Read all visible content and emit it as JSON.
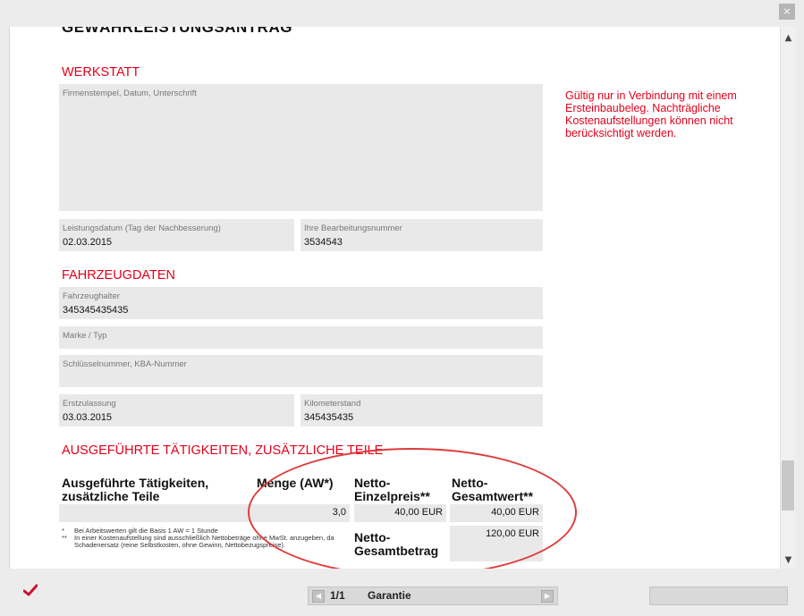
{
  "window": {
    "close_label": "×"
  },
  "document": {
    "title": "GEWÄHRLEISTUNGSANTRAG",
    "werkstatt": {
      "heading": "WERKSTATT",
      "stamp_label": "Firmenstempel, Datum, Unterschrift",
      "leistungsdatum_label": "Leistungsdatum (Tag der Nachbesserung)",
      "leistungsdatum_value": "02.03.2015",
      "bearbeitungsnummer_label": "Ihre Bearbeitungsnummer",
      "bearbeitungsnummer_value": "3534543"
    },
    "notice": "Gültig nur in Verbindung mit einem Ersteinbaubeleg. Nachträgliche Kostenaufstellungen können nicht berücksichtigt werden.",
    "fahrzeug": {
      "heading": "FAHRZEUGDATEN",
      "halter_label": "Fahrzeughalter",
      "halter_value": "345345435435",
      "marke_label": "Marke / Typ",
      "marke_value": "",
      "schluessel_label": "Schlüsselnummer, KBA-Nummer",
      "schluessel_value": "",
      "erstzulassung_label": "Erstzulassung",
      "erstzulassung_value": "03.03.2015",
      "km_label": "Kilometerstand",
      "km_value": "345435435"
    },
    "taetigkeiten": {
      "heading": "AUSGEFÜHRTE TÄTIGKEITEN, ZUSÄTZLICHE TEILE",
      "col_activity": "Ausgeführte Tätigkeiten, zusätzliche Teile",
      "col_menge": "Menge (AW*)",
      "col_einzel": "Netto-Einzelpreis**",
      "col_gesamt": "Netto-Gesamtwert**",
      "row": {
        "activity": "",
        "menge": "3,0",
        "einzel": "40,00 EUR",
        "gesamt": "40,00 EUR"
      },
      "total_label": "Netto-Gesamtbetrag",
      "total_value": "120,00 EUR",
      "footnote1_mark": "*",
      "footnote1": "Bei Arbeitswerten gilt die Basis 1 AW = 1 Stunde",
      "footnote2_mark": "**",
      "footnote2": "In einer Kostenaufstellung sind ausschließlich Nettobeträge ohne MwSt. anzugeben, da Schadenersatz (reine Selbstkosten, ohne Gewinn, Nettobezugspreise)."
    }
  },
  "pager": {
    "page": "1/1",
    "doc_name": "Garantie"
  },
  "colors": {
    "accent_red": "#e3001b",
    "field_bg": "#e9e9e9"
  }
}
